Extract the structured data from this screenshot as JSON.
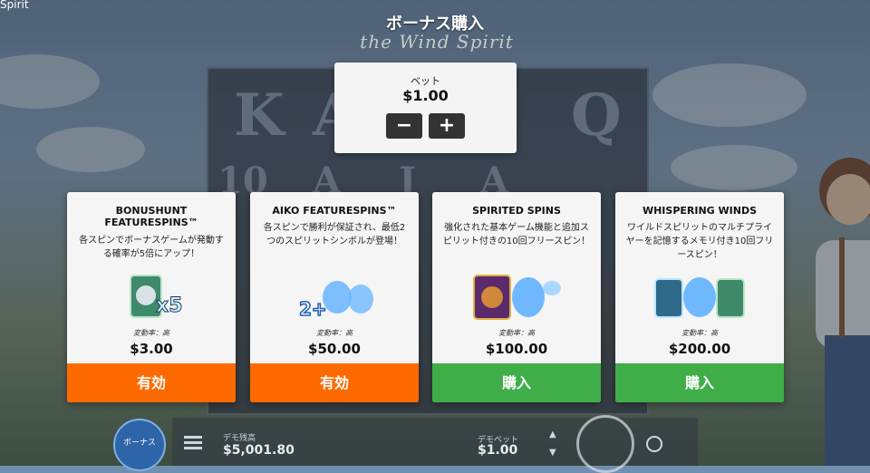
{
  "app_title": "Spirit",
  "page_title": "ボーナス購入",
  "logo_subtitle": "the Wind Spirit",
  "bet": {
    "label": "ベット",
    "value": "$1.00",
    "minus": "−",
    "plus": "+"
  },
  "cards": [
    {
      "title": "BONUSHUNT FEATURESPINS™",
      "description": "各スピンでボーナスゲームが発動する確率が5倍にアップ！",
      "volatility": "変動率：高",
      "price": "$3.00",
      "button": "有効",
      "button_color": "#ff6a00",
      "badge": "x5"
    },
    {
      "title": "AIKO FEATURESPINS™",
      "description": "各スピンで勝利が保証され、最低2つのスピリットシンボルが登場！",
      "volatility": "変動率：高",
      "price": "$50.00",
      "button": "有効",
      "button_color": "#ff6a00",
      "badge": "2+"
    },
    {
      "title": "SPIRITED SPINS",
      "description": "強化された基本ゲーム機能と追加スピリット付きの10回フリースピン！",
      "volatility": "変動率：高",
      "price": "$100.00",
      "button": "購入",
      "button_color": "#3fae49"
    },
    {
      "title": "WHISPERING WINDS",
      "description": "ワイルドスピリットのマルチプライヤーを記憶するメモリ付き10回フリースピン！",
      "volatility": "変動率：高",
      "price": "$200.00",
      "button": "購入",
      "button_color": "#3fae49"
    }
  ],
  "bottom": {
    "bonus_button": "ボーナス",
    "balance_label": "デモ残高",
    "balance_value": "$5,001.80",
    "demo_bet_label": "デモベット",
    "demo_bet_value": "$1.00"
  },
  "reels": [
    "K",
    "A",
    "Q",
    "10",
    "A",
    "J",
    "A"
  ]
}
